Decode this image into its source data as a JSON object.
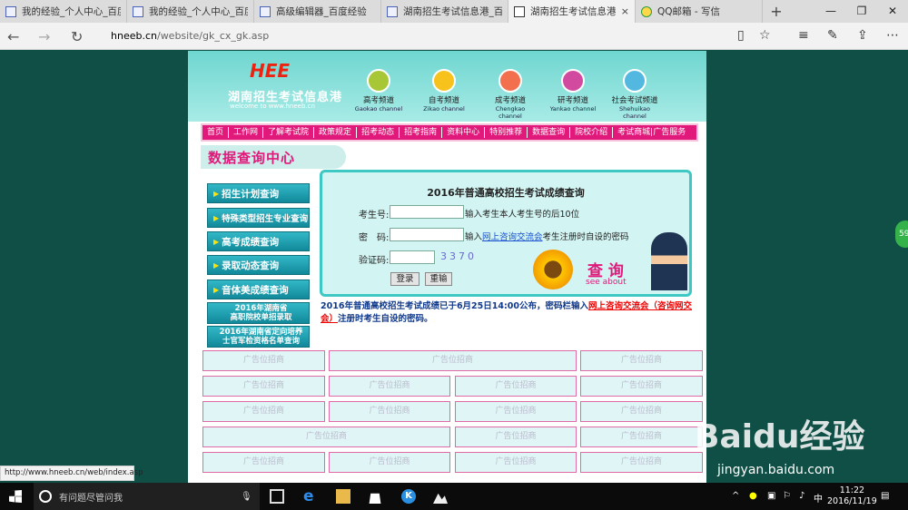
{
  "browser": {
    "tabs": [
      {
        "title": "我的经验_个人中心_百度经"
      },
      {
        "title": "我的经验_个人中心_百度经"
      },
      {
        "title": "高级编辑器_百度经验"
      },
      {
        "title": "湖南招生考试信息港_百度"
      },
      {
        "title": "湖南招生考试信息港",
        "active": true,
        "close": "×"
      },
      {
        "title": "QQ邮箱 - 写信"
      }
    ],
    "new_tab": "+",
    "win": {
      "min": "—",
      "max": "❐",
      "close": "✕"
    },
    "url_host": "hneeb.cn",
    "url_path": "/website/gk_cx_gk.asp",
    "status_url": "http://www.hneeb.cn/web/index.asp"
  },
  "site": {
    "logo_text": "湖南招生考试信息港",
    "logo_mark": "HEE",
    "welcome": "welcome to www.hneeb.cn",
    "channels": [
      {
        "cn": "高考频道",
        "en": "Gaokao channel",
        "color": "#a7c736"
      },
      {
        "cn": "自考频道",
        "en": "Zikao channel",
        "color": "#f7c21b"
      },
      {
        "cn": "成考频道",
        "en": "Chengkao channel",
        "color": "#f2704e"
      },
      {
        "cn": "研考频道",
        "en": "Yankao channel",
        "color": "#d24aa0"
      },
      {
        "cn": "社会考试频道",
        "en": "Shehuikao channel",
        "color": "#53b8e0"
      }
    ],
    "menu": [
      "首页",
      "工作网",
      "了解考试院",
      "政策规定",
      "招考动态",
      "招考指南",
      "资料中心",
      "特别推荐",
      "数据查询",
      "院校介绍",
      "考试商城|广告服务"
    ],
    "section_title": "数据查询中心",
    "side_items": [
      "招生计划查询",
      "特殊类型招生专业查询",
      "高考成绩查询",
      "录取动态查询",
      "音体美成绩查询"
    ],
    "side_two": [
      {
        "l1": "2016年湖南省",
        "l2": "高职院校单招录取"
      },
      {
        "l1": "2016年湖南省定向培养",
        "l2": "士官军检资格名单查询"
      }
    ],
    "arrow": "▶",
    "panel": {
      "title": "2016年普通高校招生考试成绩查询",
      "exam_label": "考生号:",
      "exam_hint": "输入考生本人考生号的后10位",
      "pwd_label": "密　码:",
      "pwd_hint_pre": "输入",
      "pwd_hint_link": "网上咨询交流会",
      "pwd_hint_post": "考生注册时自设的密码",
      "captcha_label": "验证码:",
      "captcha": "3370",
      "login": "登录",
      "reset": "重输",
      "chaxun": "查 询",
      "see_about": "see about"
    },
    "notice_pre": "2016年普通高校招生考试成绩已于6月25日14:00公布，密码栏输入",
    "notice_link": "网上咨询交流会（咨询网交会）",
    "notice_post": "注册时考生自设的密码。",
    "ad_label": "广告位招商"
  },
  "overlay": {
    "watermark": "Baidu经验",
    "watermark_url": "jingyan.baidu.com",
    "badge": "59"
  },
  "taskbar": {
    "search": "有问题尽管问我",
    "ime": "中",
    "time": "11:22",
    "date": "2016/11/19"
  }
}
